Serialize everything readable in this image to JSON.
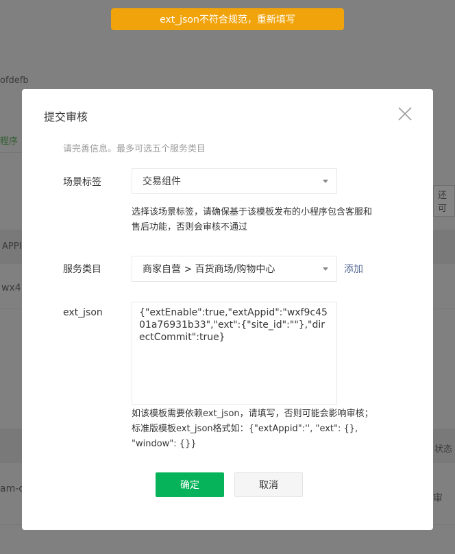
{
  "toast": {
    "text": "ext_json不符合规范，重新填写"
  },
  "background": {
    "fragments": [
      "ofdefb",
      "程序",
      "还可",
      "APPI",
      "wx41",
      "状态",
      "am-c",
      "审"
    ]
  },
  "dialog": {
    "title": "提交审核",
    "description": "请完善信息。最多可选五个服务类目",
    "scene_tag": {
      "label": "场景标签",
      "selected": "交易组件",
      "hint": "选择该场景标签，请确保基于该模板发布的小程序包含客服和售后功能，否则会审核不通过"
    },
    "service_category": {
      "label": "服务类目",
      "selected": "商家自营 > 百货商场/购物中心",
      "add_label": "添加"
    },
    "ext_json": {
      "label": "ext_json",
      "value": "{\"extEnable\":true,\"extAppid\":\"wxf9c4501a76931b33\",\"ext\":{\"site_id\":\"\"},\"directCommit\":true}",
      "hint": "如该模板需要依赖ext_json，请填写，否则可能会影响审核；标准版模板ext_json格式如：{\"extAppid\":'', \"ext\": {}, \"window\": {}}"
    },
    "confirm_label": "确定",
    "cancel_label": "取消"
  },
  "colors": {
    "toast_bg": "#f0a30a",
    "primary": "#07b35a",
    "link": "#576b95",
    "overlay": "#808080"
  }
}
